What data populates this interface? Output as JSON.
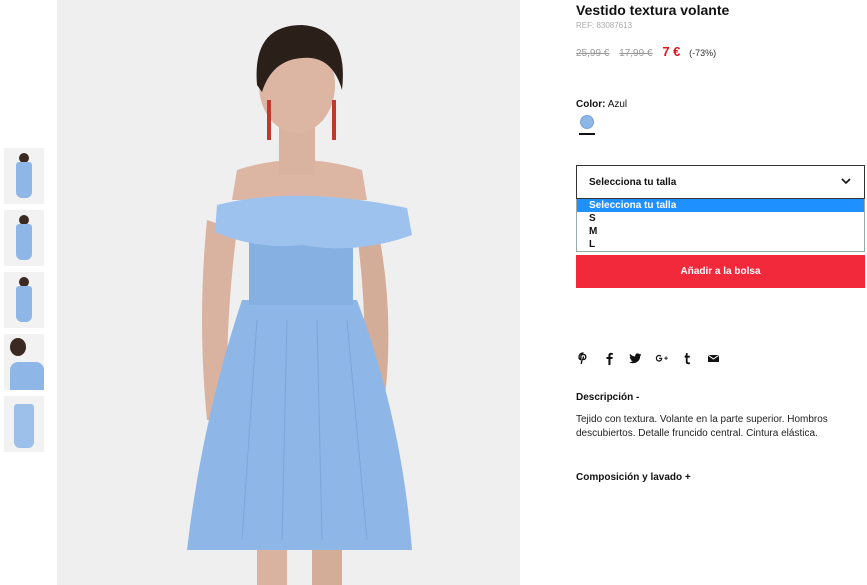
{
  "product": {
    "title": "Vestido textura volante",
    "ref": "REF: 83087613",
    "price_original": "25,99 €",
    "price_previous": "17,99 €",
    "price_sale": "7 €",
    "discount": "(-73%)"
  },
  "color": {
    "label": "Color:",
    "value": "Azul",
    "swatch_hex": "#8eb7e8"
  },
  "size": {
    "select_label": "Selecciona tu talla",
    "options": [
      "Selecciona tu talla",
      "S",
      "M",
      "L"
    ],
    "selected_index": 0
  },
  "cart": {
    "add_label": "Añadir a la bolsa",
    "accent": "#f2293a"
  },
  "share": {
    "icons": [
      "pinterest-icon",
      "facebook-icon",
      "twitter-icon",
      "google-plus-icon",
      "tumblr-icon",
      "email-icon"
    ]
  },
  "description": {
    "title": "Descripción -",
    "text": "Tejido con textura. Volante en la parte superior. Hombros descubiertos. Detalle fruncido central. Cintura elástica."
  },
  "composition": {
    "title": "Composición y lavado +"
  },
  "colors": {
    "price_sale": "#e0141e",
    "dress": "#8eb7e8",
    "selected_option": "#1e90ff"
  }
}
